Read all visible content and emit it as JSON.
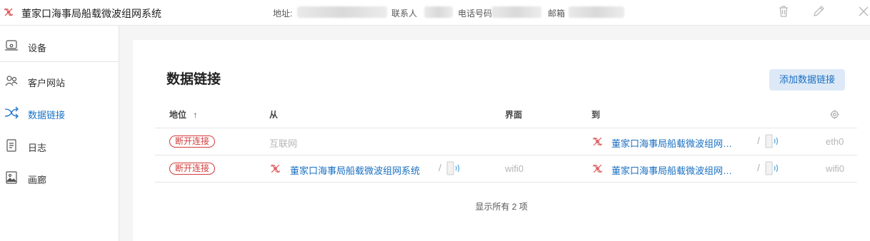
{
  "app": {
    "title": "董家口海事局船载微波组网系统",
    "address_label": "地址:",
    "contact_label": "联系人",
    "phone_label": "电话号码",
    "email_label": "邮箱"
  },
  "toolbar": {
    "delete_icon": "trash-icon",
    "edit_icon": "pencil-icon",
    "close_icon": "close-icon"
  },
  "sidebar": {
    "items": [
      {
        "label": "设备",
        "icon": "device-icon"
      },
      {
        "label": "客户网站",
        "icon": "network-site-icon"
      },
      {
        "label": "数据链接",
        "icon": "shuffle-link-icon",
        "active": true
      },
      {
        "label": "日志",
        "icon": "log-icon"
      },
      {
        "label": "画廊",
        "icon": "gallery-icon"
      }
    ]
  },
  "main": {
    "title": "数据链接",
    "add_button": "添加数据链接",
    "columns": {
      "status": "地位",
      "sort_indicator": "↑",
      "from": "从",
      "interface": "界面",
      "to": "到",
      "settings_icon": "gear-icon"
    },
    "rows": [
      {
        "status": "断开连接",
        "from": "互联网",
        "from_interface": "",
        "to": "董家口海事局船载微波组网…",
        "to_interface": "eth0"
      },
      {
        "status": "断开连接",
        "from": "董家口海事局船载微波组网系统",
        "from_interface": "wifi0",
        "to": "董家口海事局船载微波组网…",
        "to_interface": "wifi0"
      }
    ],
    "footer": "显示所有 2 项"
  },
  "colors": {
    "accent": "#1a6fc2",
    "danger": "#d23c3c",
    "logo": "#e06060"
  }
}
